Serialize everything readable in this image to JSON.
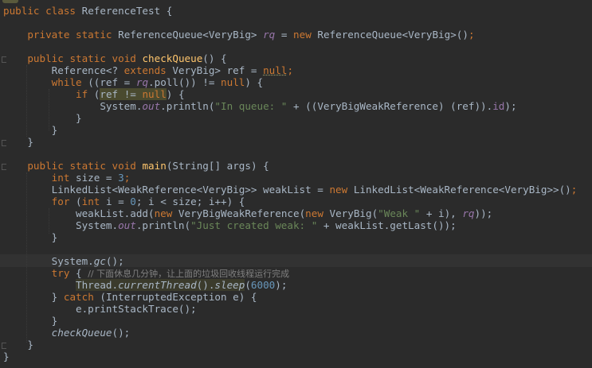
{
  "code": {
    "class_decl": {
      "kw1": "public",
      "kw2": "class",
      "name": "ReferenceTest",
      "brace": "{"
    },
    "field_line": {
      "kw1": "private",
      "kw2": "static",
      "type": "ReferenceQueue<VeryBig>",
      "var": "rq",
      "eq": "=",
      "kw3": "new",
      "ctor": "ReferenceQueue<VeryBig>",
      "tail": "()",
      "semi": ";"
    },
    "check_decl": {
      "kw1": "public",
      "kw2": "static",
      "kw3": "void",
      "name": "checkQueue",
      "tail": "() {"
    },
    "ref_decl": {
      "type1": "Reference<?",
      "kw": "extends",
      "type2": "VeryBig> ref =",
      "nullv": "null",
      "semi": ";"
    },
    "while_line": {
      "kw": "while",
      "pre": "((ref =",
      "var": "rq",
      "mid": ".poll()) !=",
      "nullv": "null",
      "tail": ") {"
    },
    "if_line": {
      "kw": "if",
      "open": "(",
      "cond1": "ref !=",
      "nullv": "null",
      "tail": ") {"
    },
    "print1": {
      "obj": "System.",
      "field": "out",
      "call": ".println(",
      "str": "\"In queue: \"",
      "mid": " + ((VeryBigWeakReference) (ref)).",
      "field2": "id",
      "tail": ");"
    },
    "close_if": "}",
    "close_while": "}",
    "close_check": "}",
    "main_decl": {
      "kw1": "public",
      "kw2": "static",
      "kw3": "void",
      "name": "main",
      "tail": "(String[] args) {"
    },
    "size_line": {
      "kw": "int",
      "mid": "size =",
      "num": "3",
      "semi": ";"
    },
    "list_line": {
      "pre": "LinkedList<WeakReference<VeryBig>> weakList =",
      "kw": "new",
      "post": "LinkedList<WeakReference<VeryBig>>()",
      "semi": ";"
    },
    "for_line": {
      "kw": "for",
      "open": "(",
      "kw2": "int",
      "a": "i =",
      "num": "0",
      "b": "; i < size; i++) {"
    },
    "add_line": {
      "pre": "weakList.add(",
      "kw": "new",
      "a": "VeryBigWeakReference(",
      "kw2": "new",
      "b": "VeryBig(",
      "str": "\"Weak \"",
      "c": " + i),",
      "var": "rq",
      "tail": "));"
    },
    "print2": {
      "obj": "System.",
      "field": "out",
      "call": ".println(",
      "str": "\"Just created weak: \"",
      "tail": " + weakList.getLast());"
    },
    "close_for": "}",
    "gc_line": {
      "obj": "System.",
      "meth": "gc",
      "tail": "();"
    },
    "try_line": {
      "kw": "try",
      "brace": "{",
      "comment": "// 下面休息几分钟，让上面的垃圾回收线程运行完成"
    },
    "sleep_line": {
      "cls": "Thread.",
      "meth1": "currentThread",
      "mid": "().",
      "meth2": "sleep",
      "open": "(",
      "num": "6000",
      "tail": ");"
    },
    "catch_line": {
      "brace": "}",
      "kw": "catch",
      "tail": "(InterruptedException e) {"
    },
    "trace_line": {
      "text": "e.printStackTrace();"
    },
    "close_try": "}",
    "call_check": {
      "meth": "checkQueue",
      "tail": "();"
    },
    "close_main": "}",
    "close_class": "}"
  }
}
